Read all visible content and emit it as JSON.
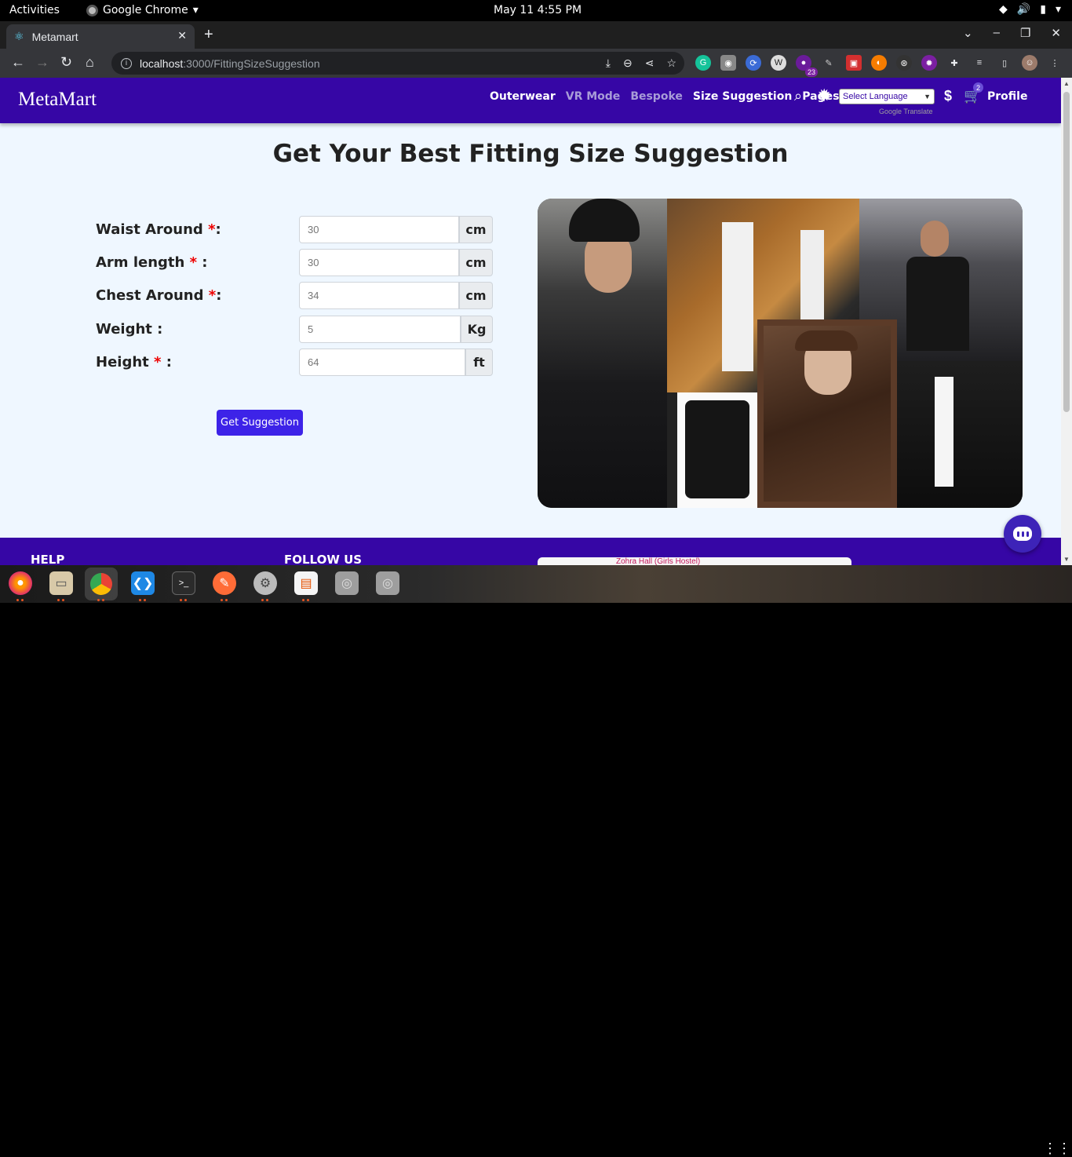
{
  "system": {
    "activities": "Activities",
    "app_name": "Google Chrome",
    "clock": "May 11  4:55 PM"
  },
  "browser": {
    "tab_title": "Metamart",
    "url_host": "localhost",
    "url_path": ":3000/FittingSizeSuggestion",
    "extension_badge": "23"
  },
  "navbar": {
    "brand": "MetaMart",
    "links": [
      {
        "label": "Outerwear",
        "dim": false
      },
      {
        "label": "VR Mode",
        "dim": true
      },
      {
        "label": "Bespoke",
        "dim": true
      },
      {
        "label": "Size Suggestion",
        "dim": false
      },
      {
        "label": "Pages",
        "dim": false
      }
    ],
    "language_select": "Select Language",
    "powered_by": "Google Translate",
    "currency_symbol": "$",
    "cart_count": "2",
    "profile": "Profile"
  },
  "page": {
    "heading": "Get Your Best Fitting Size Suggestion",
    "fields": [
      {
        "label": "Waist Around ",
        "required": true,
        "suffix": ":",
        "value": "30",
        "unit": "cm"
      },
      {
        "label": "Arm length ",
        "required": true,
        "suffix": " :",
        "value": "30",
        "unit": "cm"
      },
      {
        "label": "Chest Around ",
        "required": true,
        "suffix": ":",
        "value": "34",
        "unit": "cm"
      },
      {
        "label": "Weight :",
        "required": false,
        "suffix": "",
        "value": "5",
        "unit": "Kg"
      },
      {
        "label": "Height ",
        "required": true,
        "suffix": " :",
        "value": "64",
        "unit": "ft"
      }
    ],
    "submit_label": "Get Suggestion"
  },
  "footer": {
    "help": "HELP",
    "follow": "FOLLOW US",
    "map_label": "Zohra Hall (Girls Hostel)"
  },
  "colors": {
    "navbar": "#3606a5",
    "button": "#3d23e8",
    "page_bg": "#eff7ff",
    "required_star": "#e00000"
  }
}
